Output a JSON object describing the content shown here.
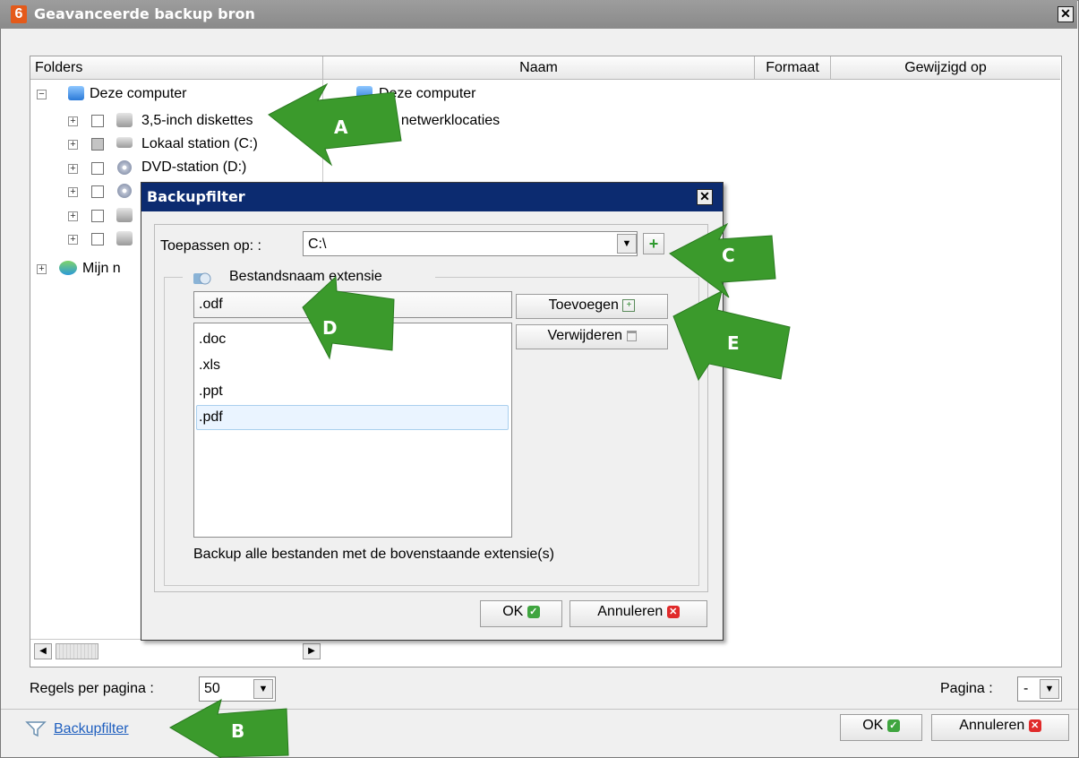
{
  "window": {
    "title": "Geavanceerde backup bron",
    "app_icon": "6"
  },
  "columns": {
    "folders": "Folders",
    "naam": "Naam",
    "formaat": "Formaat",
    "gewijzigd": "Gewijzigd op"
  },
  "tree": {
    "root": "Deze computer",
    "items": [
      "3,5-inch diskettes",
      "Lokaal station (C:)",
      "DVD-station (D:)"
    ],
    "network": "Mijn n"
  },
  "content": {
    "items": [
      "Deze computer",
      "jn netwerklocaties"
    ]
  },
  "footer": {
    "rows_label": "Regels per pagina :",
    "rows_value": "50",
    "page_label": "Pagina :",
    "page_value": "-",
    "filter_link": "Backupfilter",
    "ok": "OK",
    "cancel": "Annuleren"
  },
  "dialog": {
    "title": "Backupfilter",
    "apply_label": "Toepassen op: :",
    "apply_value": "C:\\",
    "group_legend": "Bestandsnaam extensie",
    "ext_input": ".odf",
    "extensions": [
      ".doc",
      ".xls",
      ".ppt",
      ".pdf"
    ],
    "selected_extension": ".pdf",
    "add_button": "Toevoegen",
    "delete_button": "Verwijderen",
    "caption": "Backup alle bestanden met de bovenstaande extensie(s)",
    "ok": "OK",
    "cancel": "Annuleren"
  },
  "callouts": [
    "A",
    "B",
    "C",
    "D",
    "E"
  ],
  "colors": {
    "callout_green": "#3b9a2c",
    "dialog_title_bg": "#0c2b70",
    "main_title_bg": "#8f8f8f"
  }
}
